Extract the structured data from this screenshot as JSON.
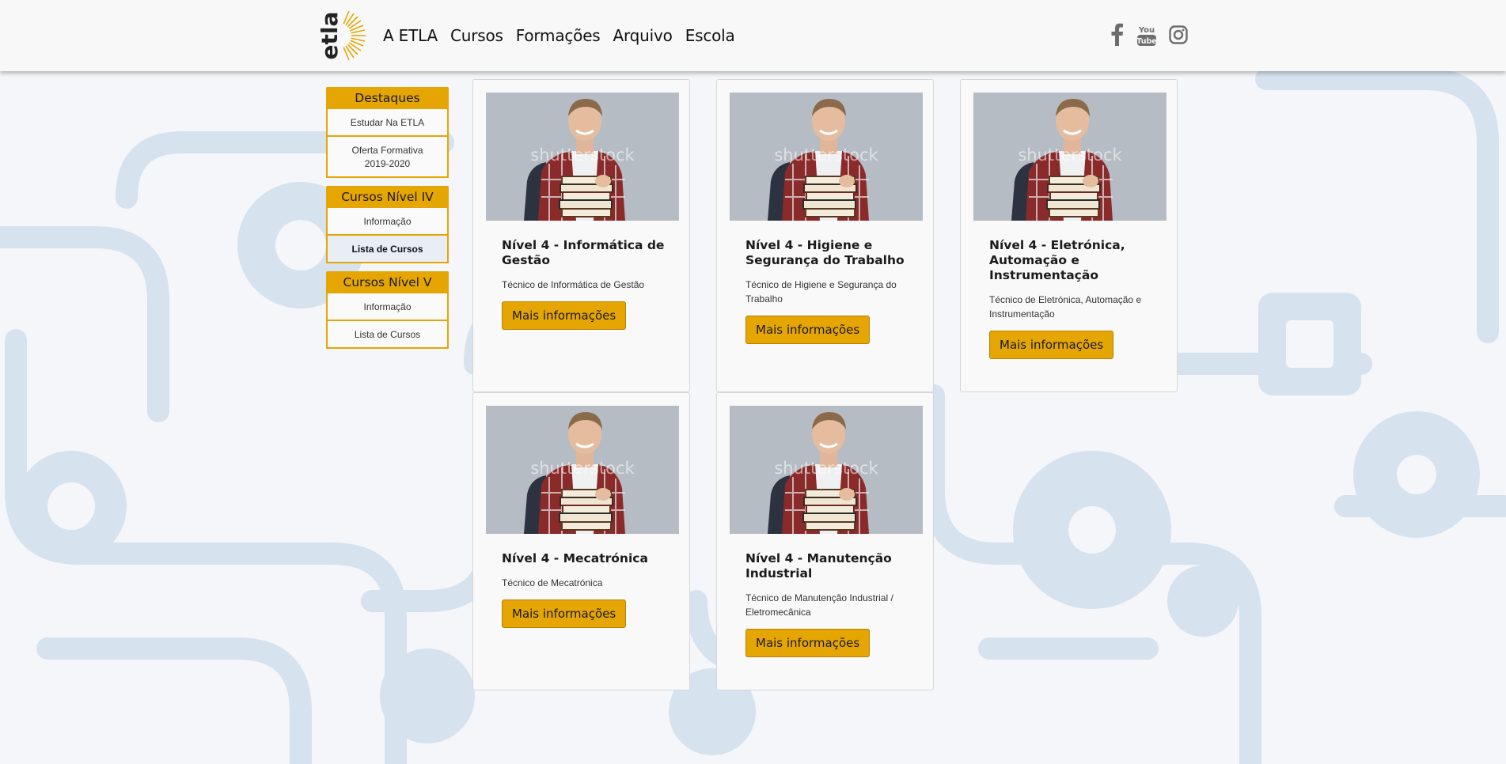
{
  "header": {
    "logo_text": "etla",
    "nav": [
      "A ETLA",
      "Cursos",
      "Formações",
      "Arquivo",
      "Escola"
    ],
    "social_icons": [
      "facebook-icon",
      "youtube-icon",
      "instagram-icon"
    ],
    "youtube_text": {
      "top": "You",
      "bottom": "Tube"
    }
  },
  "sidebar": {
    "groups": [
      {
        "title": "Destaques",
        "items": [
          "Estudar Na ETLA",
          "Oferta Formativa 2019-2020"
        ]
      },
      {
        "title": "Cursos Nível IV",
        "items": [
          "Informação",
          "Lista de Cursos"
        ],
        "active_index": 1
      },
      {
        "title": "Cursos Nível V",
        "items": [
          "Informação",
          "Lista de Cursos"
        ]
      }
    ]
  },
  "image_watermark": "shutterstock",
  "colors": {
    "accent": "#e5a503",
    "pattern": "#d6e2ee"
  },
  "courses": [
    {
      "title": "Nível 4 - Informática de Gestão",
      "description": "Técnico de Informática de Gestão",
      "button": "Mais informações"
    },
    {
      "title": "Nível 4 - Higiene e Segurança do Trabalho",
      "description": "Técnico de Higiene e Segurança do Trabalho",
      "button": "Mais informações"
    },
    {
      "title": "Nível 4 - Eletrónica, Automação e Instrumentação",
      "description": "Técnico de Eletrónica, Automação e Instrumentação",
      "button": "Mais informações"
    },
    {
      "title": "Nível 4 - Mecatrónica",
      "description": "Técnico de Mecatrónica",
      "button": "Mais informações"
    },
    {
      "title": "Nível 4 - Manutenção Industrial",
      "description": "Técnico de Manutenção Industrial / Eletromecânica",
      "button": "Mais informações"
    }
  ]
}
